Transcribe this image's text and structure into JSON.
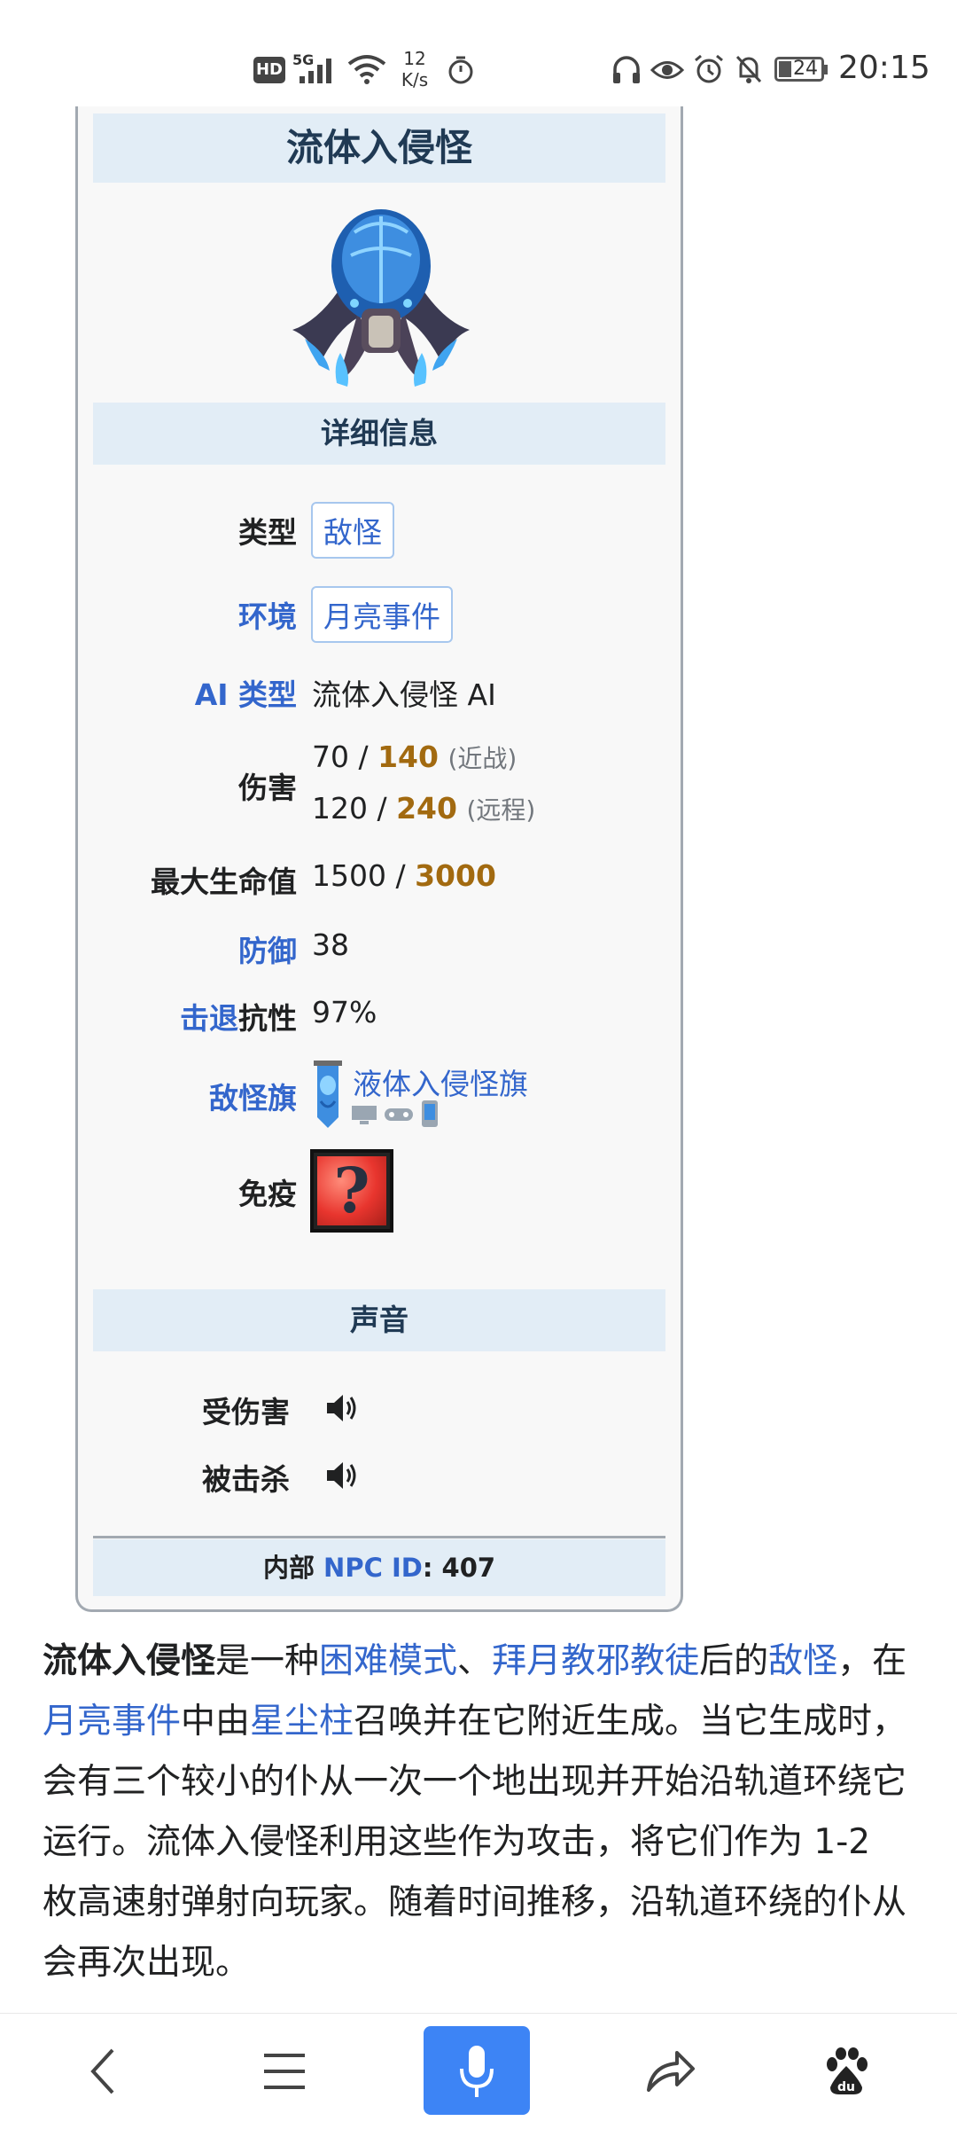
{
  "status_bar": {
    "hd": "HD",
    "net": "5G",
    "speed_value": "12",
    "speed_unit": "K/s",
    "battery": "24",
    "time": "20:15"
  },
  "infobox": {
    "title": "流体入侵怪",
    "details_header": "详细信息",
    "rows": {
      "type": {
        "label": "类型",
        "value": "敌怪"
      },
      "environment": {
        "label": "环境",
        "value": "月亮事件"
      },
      "ai_type": {
        "label": "AI 类型",
        "value": "流体入侵怪 AI"
      },
      "damage": {
        "label": "伤害",
        "melee_normal": "70 / ",
        "melee_expert": "140",
        "melee_note": "(近战)",
        "ranged_normal": "120 / ",
        "ranged_expert": "240",
        "ranged_note": "(远程)"
      },
      "max_life": {
        "label": "最大生命值",
        "normal": "1500 / ",
        "expert": "3000"
      },
      "defense": {
        "label": "防御",
        "value": "38"
      },
      "kb": {
        "label_link": "击退",
        "label_rest": "抗性",
        "value": "97%"
      },
      "banner": {
        "label": "敌怪旗",
        "value": "液体入侵怪旗"
      },
      "immune": {
        "label": "免疫"
      }
    },
    "sound_header": "声音",
    "sounds": {
      "hurt": "受伤害",
      "killed": "被击杀"
    },
    "footer": {
      "pre": "内部 ",
      "link": "NPC ID",
      "post": ": 407"
    }
  },
  "article": {
    "t1": "流体入侵怪",
    "t2": "是一种",
    "l1": "困难模式",
    "t3": "、",
    "l2": "拜月教邪教徒",
    "t4": "后的",
    "l3": "敌怪",
    "t5": "，在",
    "l4": "月亮事件",
    "t6": "中由",
    "l5": "星尘柱",
    "t7": "召唤并在它附近生成。当它生成时，会有三个较小的仆从一次一个地出现并开始沿轨道环绕它运行。流体入侵怪利用这些作为攻击，将它们作为 1-2 枚高速射弹射向玩家。随着时间推移，沿轨道环绕的仆从会再次出现。"
  },
  "nav": {
    "icons": [
      "back-icon",
      "menu-icon",
      "microphone-icon",
      "share-icon",
      "baidu-paw-icon"
    ],
    "accent": "#3d84f5"
  }
}
